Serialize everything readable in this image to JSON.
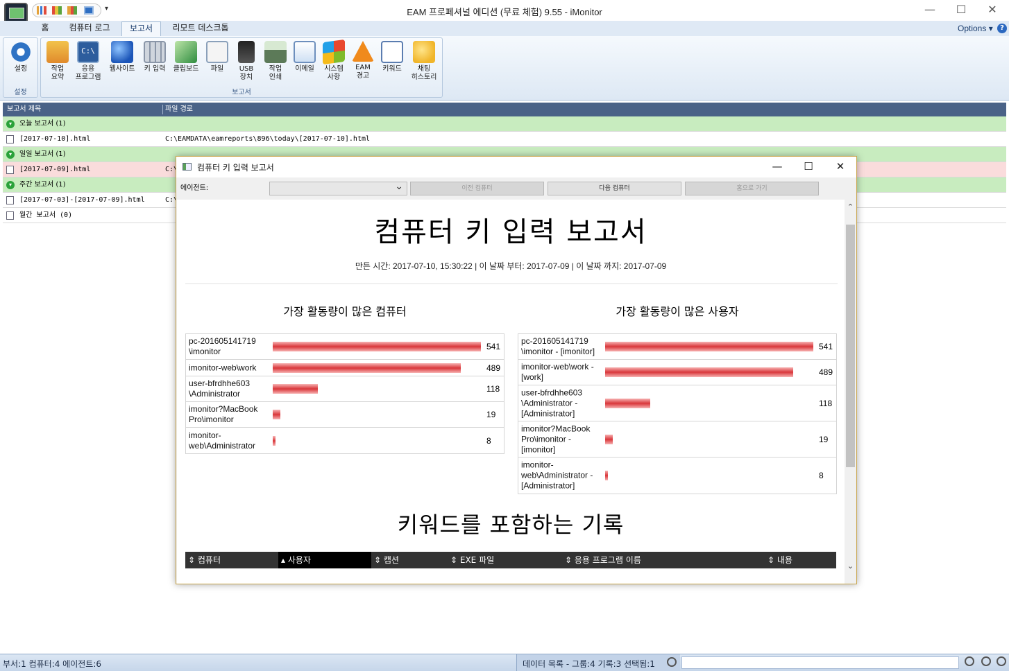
{
  "window": {
    "title": "EAM 프로페셔널 에디션 (무료 체험) 9.55 - iMonitor",
    "controls": {
      "minimize": "—",
      "maximize": "☐",
      "close": "✕"
    },
    "qat_dropdown": "▾"
  },
  "ribbon_tabs": [
    {
      "label": "홈"
    },
    {
      "label": "컴퓨터 로그"
    },
    {
      "label": "보고서"
    },
    {
      "label": "리모트 데스크톱"
    }
  ],
  "options_label": "Options ▾",
  "help_label": "?",
  "ribbon": {
    "group_settings": {
      "label": "설정",
      "buttons": [
        {
          "label": "설정",
          "icon": "gear-icon"
        }
      ]
    },
    "group_reports": {
      "label": "보고서",
      "buttons": [
        {
          "label": "작업\n요약",
          "icon": "people-icon"
        },
        {
          "label": "응용\n프로그램",
          "icon": "terminal-icon"
        },
        {
          "label": "웹사이트",
          "icon": "globe-icon"
        },
        {
          "label": "키 입력",
          "icon": "keyboard-icon"
        },
        {
          "label": "클립보드",
          "icon": "clipboard-icon"
        },
        {
          "label": "파일",
          "icon": "file-icon"
        },
        {
          "label": "USB\n장치",
          "icon": "usb-icon"
        },
        {
          "label": "작업\n인쇄",
          "icon": "printer-icon"
        },
        {
          "label": "이메일",
          "icon": "mail-icon"
        },
        {
          "label": "시스템\n사항",
          "icon": "windows-icon"
        },
        {
          "label": "EAM\n경고",
          "icon": "warning-icon"
        },
        {
          "label": "키워드",
          "icon": "keyword-doc-icon"
        },
        {
          "label": "채팅\n히스토리",
          "icon": "chat-icon"
        }
      ]
    }
  },
  "list": {
    "headers": {
      "title": "보고서 제목",
      "path": "파일 경로"
    },
    "rows": [
      {
        "type": "group",
        "title": "오늘 보고서 (1)",
        "path": ""
      },
      {
        "type": "file",
        "title": "[2017-07-10].html",
        "path": "C:\\EAMDATA\\eamreports\\896\\today\\[2017-07-10].html"
      },
      {
        "type": "group",
        "title": "일일 보고서 (1)",
        "path": ""
      },
      {
        "type": "file",
        "title": "[2017-07-09].html",
        "path": "C:\\"
      },
      {
        "type": "group",
        "title": "주간 보고서 (1)",
        "path": ""
      },
      {
        "type": "file",
        "title": "[2017-07-03]-[2017-07-09].html",
        "path": "C:\\"
      },
      {
        "type": "file",
        "title": "월간 보고서 (0)",
        "path": ""
      }
    ]
  },
  "status": {
    "left": "부서:1  컴퓨터:4  에이전트:6",
    "right": "데이터 목록 - 그룹:4  기록:3  선택됨:1"
  },
  "dialog": {
    "title": "컴퓨터 키 입력 보고서",
    "controls": {
      "minimize": "—",
      "maximize": "☐",
      "close": "✕"
    },
    "agent_label": "에이전트:",
    "buttons": {
      "prev": "이전 컴퓨터",
      "next": "다음 컴퓨터",
      "home": "홈으로 가기"
    },
    "report": {
      "title": "컴퓨터 키 입력 보고서",
      "meta": "만든 시간: 2017-07-10, 15:30:22 | 이 날짜 부터: 2017-07-09 | 이 날짜 까지: 2017-07-09",
      "computers_title": "가장 활동량이 많은 컴퓨터",
      "users_title": "가장 활동량이 많은 사용자",
      "computers": [
        {
          "name": "pc-201605141719\n\\imonitor",
          "value": 541
        },
        {
          "name": "imonitor-web\\work",
          "value": 489
        },
        {
          "name": "user-bfrdhhe603\n\\Administrator",
          "value": 118
        },
        {
          "name": "imonitor?MacBook\nPro\\imonitor",
          "value": 19
        },
        {
          "name": "imonitor-\nweb\\Administrator",
          "value": 8
        }
      ],
      "users": [
        {
          "name": "pc-201605141719\n\\imonitor - [imonitor]",
          "value": 541
        },
        {
          "name": "imonitor-web\\work -\n[work]",
          "value": 489
        },
        {
          "name": "user-bfrdhhe603\n\\Administrator -\n[Administrator]",
          "value": 118
        },
        {
          "name": "imonitor?MacBook\nPro\\imonitor -\n[imonitor]",
          "value": 19
        },
        {
          "name": "imonitor-\nweb\\Administrator -\n[Administrator]",
          "value": 8
        }
      ],
      "keyword_title": "키워드를 포함하는 기록",
      "keyword_columns": [
        {
          "label": "⇕ 컴퓨터"
        },
        {
          "label": "▴ 사용자"
        },
        {
          "label": "⇕ 캡션"
        },
        {
          "label": "⇕ EXE 파일"
        },
        {
          "label": "⇕ 응용 프로그램 이름"
        },
        {
          "label": "⇕ 내용"
        }
      ]
    }
  },
  "colors": {
    "group_row": "#c8ecbf",
    "selected_row": "#fadcdc",
    "bar": "#d9363a",
    "list_header": "#4a6287"
  }
}
